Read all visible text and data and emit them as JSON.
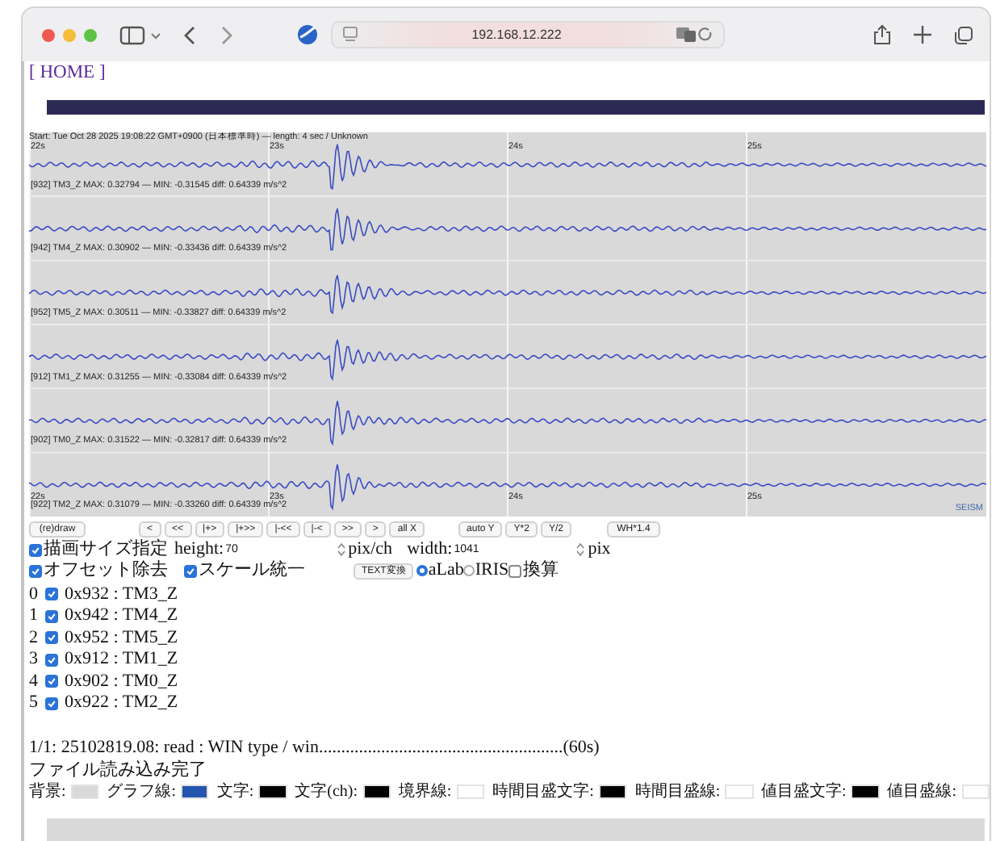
{
  "browser": {
    "url": "192.168.12.222"
  },
  "home_link": "[ HOME ]",
  "plot": {
    "header": "Start: Tue Oct 28 2025 19:08:22 GMT+0900 (日本標準時) — length: 4 sec / Unknown",
    "time_labels": [
      "22s",
      "23s",
      "24s",
      "25s"
    ],
    "channels": [
      {
        "label": "[932] TM3_Z  MAX: 0.32794 — MIN: -0.31545  diff: 0.64339 m/s^2"
      },
      {
        "label": "[942] TM4_Z  MAX: 0.30902 — MIN: -0.33436  diff: 0.64339 m/s^2"
      },
      {
        "label": "[952] TM5_Z  MAX: 0.30511 — MIN: -0.33827  diff: 0.64339 m/s^2"
      },
      {
        "label": "[912] TM1_Z  MAX: 0.31255 — MIN: -0.33084  diff: 0.64339 m/s^2"
      },
      {
        "label": "[902] TM0_Z  MAX: 0.31522 — MIN: -0.32817  diff: 0.64339 m/s^2"
      },
      {
        "label": "[922] TM2_Z  MAX: 0.31079 — MIN: -0.33260  diff: 0.64339 m/s^2"
      }
    ],
    "bottom_time_labels": [
      "22s",
      "23s",
      "24s",
      "25s"
    ],
    "brand": "SEISM"
  },
  "button_groups": [
    [
      "(re)draw"
    ],
    [
      "<",
      "<<",
      "|+>",
      "|+>>",
      "|-<<",
      "|-<",
      ">>",
      ">",
      "all X"
    ],
    [
      "auto Y",
      "Y*2",
      "Y/2"
    ],
    [
      "WH*1.4"
    ]
  ],
  "size_row": {
    "checkbox": {
      "label": "描画サイズ指定",
      "checked": true
    },
    "height_label": "height:",
    "height_value": "70",
    "height_unit": "pix/ch",
    "width_label": "width:",
    "width_value": "1041",
    "width_unit": "pix"
  },
  "options_row": {
    "checkboxes": [
      {
        "label": "オフセット除去",
        "checked": true
      },
      {
        "label": "スケール統一",
        "checked": true
      }
    ],
    "text_button": "TEXT変換",
    "radios": [
      {
        "label": "aLab",
        "selected": true
      },
      {
        "label": "IRIS",
        "selected": false
      }
    ],
    "convert": {
      "label": "換算",
      "checked": false
    }
  },
  "channel_list": [
    {
      "index": "0",
      "label": "0x932 : TM3_Z",
      "checked": true
    },
    {
      "index": "1",
      "label": "0x942 : TM4_Z",
      "checked": true
    },
    {
      "index": "2",
      "label": "0x952 : TM5_Z",
      "checked": true
    },
    {
      "index": "3",
      "label": "0x912 : TM1_Z",
      "checked": true
    },
    {
      "index": "4",
      "label": "0x902 : TM0_Z",
      "checked": true
    },
    {
      "index": "5",
      "label": "0x922 : TM2_Z",
      "checked": true
    }
  ],
  "status_lines": [
    "1/1: 25102819.08: read : WIN type / win.......................................................(60s)",
    "ファイル読み込み完了"
  ],
  "colors": [
    {
      "label": "背景:",
      "color": "#d9d9d9"
    },
    {
      "label": "グラフ線:",
      "color": "#2456b0"
    },
    {
      "label": "文字:",
      "color": "#000000"
    },
    {
      "label": "文字(ch):",
      "color": "#000000"
    },
    {
      "label": "境界線:",
      "color": "#ffffff"
    },
    {
      "label": "時間目盛文字:",
      "color": "#000000"
    },
    {
      "label": "時間目盛線:",
      "color": "#ffffff"
    },
    {
      "label": "値目盛文字:",
      "color": "#000000"
    },
    {
      "label": "値目盛線:",
      "color": "#ffffff"
    }
  ]
}
